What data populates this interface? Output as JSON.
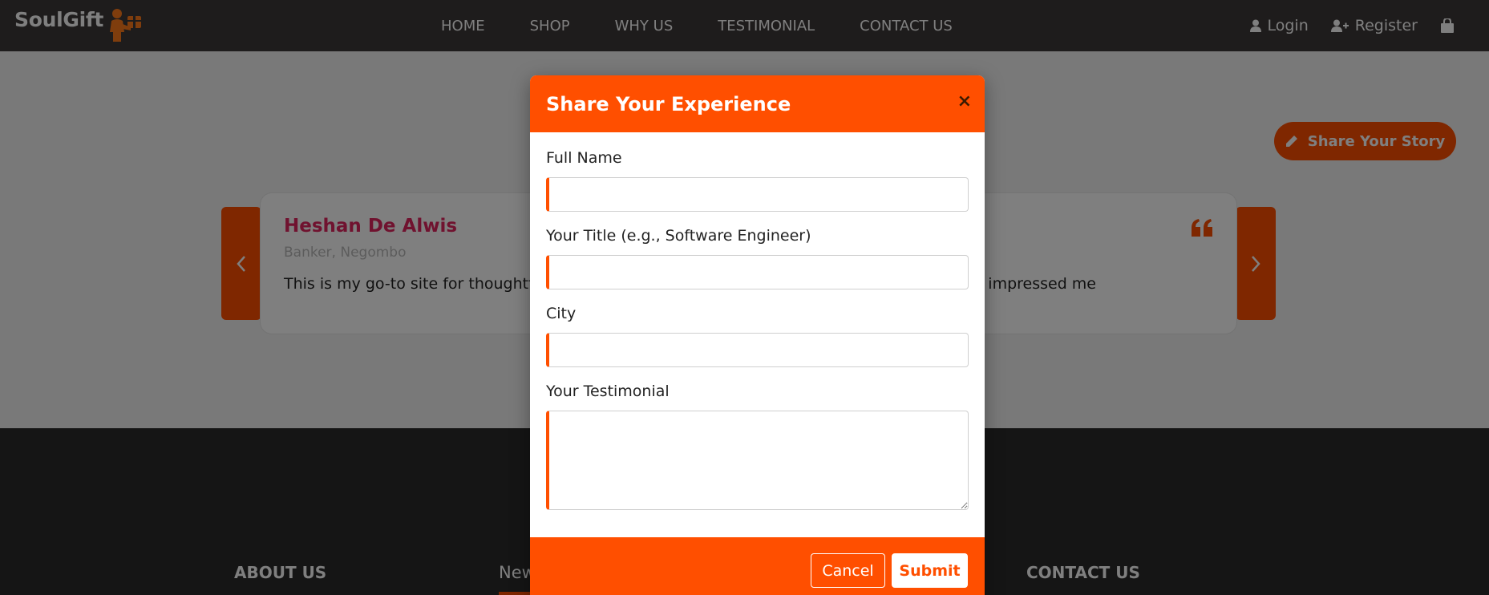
{
  "brand": {
    "name": "SoulGift"
  },
  "nav": {
    "links": [
      "HOME",
      "SHOP",
      "WHY US",
      "TESTIMONIAL",
      "CONTACT US"
    ],
    "login": "Login",
    "register": "Register"
  },
  "page": {
    "share_button": "Share Your Story",
    "testimonial": {
      "name": "Heshan De Alwis",
      "role": "Banker, Negombo",
      "text_visible_left": "This is my go-to site for thoughtful",
      "text_visible_right": "y impressed me"
    }
  },
  "footer": {
    "about": "ABOUT US",
    "news": "New",
    "contact": "CONTACT US"
  },
  "modal": {
    "title": "Share Your Experience",
    "close": "×",
    "fields": {
      "full_name_label": "Full Name",
      "title_label": "Your Title (e.g., Software Engineer)",
      "city_label": "City",
      "testimonial_label": "Your Testimonial"
    },
    "cancel": "Cancel",
    "submit": "Submit"
  },
  "colors": {
    "accent": "#ff4f00",
    "nav_bg": "#3d3838",
    "footer_bg": "#2a2a2a",
    "name_color": "#e0245e"
  }
}
